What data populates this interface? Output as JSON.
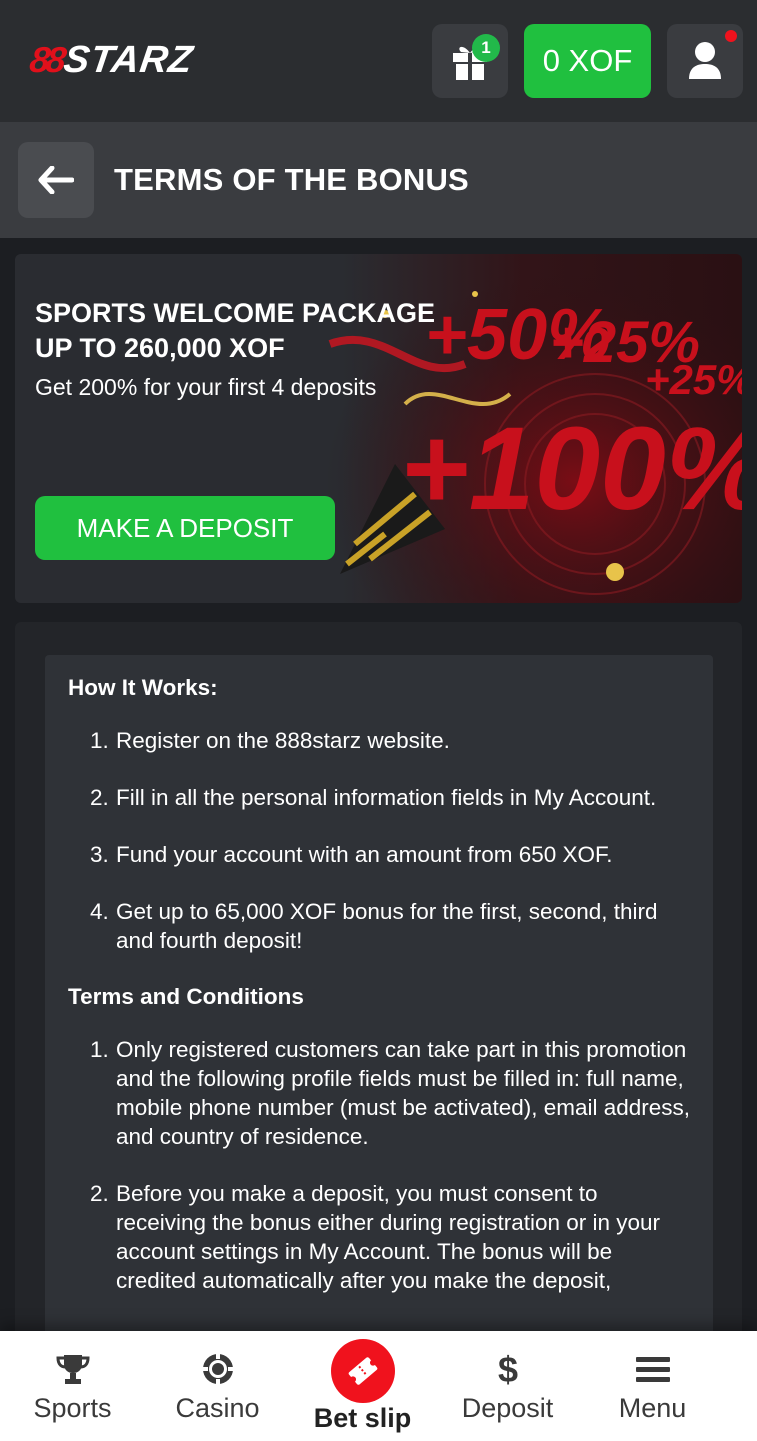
{
  "header": {
    "logo_mark": "88",
    "logo_word": "STARZ",
    "gift_badge_count": "1",
    "balance": "0 XOF"
  },
  "titlebar": {
    "title": "TERMS OF THE BONUS"
  },
  "banner": {
    "title": "SPORTS WELCOME PACKAGE UP TO 260,000 XOF",
    "subtitle": "Get 200% for your first 4 deposits",
    "button_label": "MAKE A DEPOSIT",
    "art_texts": [
      "+50%",
      "+25%",
      "+100%",
      "+25%"
    ]
  },
  "terms": {
    "how_title": "How It Works:",
    "how_items": [
      "Register on the 888starz website.",
      "Fill in all the personal information fields in My Account.",
      "Fund your account with an amount from 650 XOF.",
      "Get up to 65,000 XOF bonus for the first, second, third and fourth deposit!"
    ],
    "conditions_title": "Terms and Conditions",
    "conditions_items": [
      "Only registered customers can take part in this promotion and the following profile fields must be filled in: full name, mobile phone number (must be activated), email address, and country of residence.",
      "Before you make a deposit, you must consent to receiving the bonus either during registration or in your account settings in My Account. The bonus will be credited automatically after you make the deposit,"
    ]
  },
  "bottom_nav": {
    "items": [
      {
        "label": "Sports",
        "icon": "trophy-icon"
      },
      {
        "label": "Casino",
        "icon": "casino-chip-icon"
      },
      {
        "label": "Bet slip",
        "icon": "ticket-icon"
      },
      {
        "label": "Deposit",
        "icon": "dollar-icon"
      },
      {
        "label": "Menu",
        "icon": "hamburger-icon"
      }
    ]
  },
  "colors": {
    "accent_green": "#20c03f",
    "brand_red": "#e0101b",
    "header_bg": "#2b2d30",
    "card_bg": "#2f3237"
  }
}
